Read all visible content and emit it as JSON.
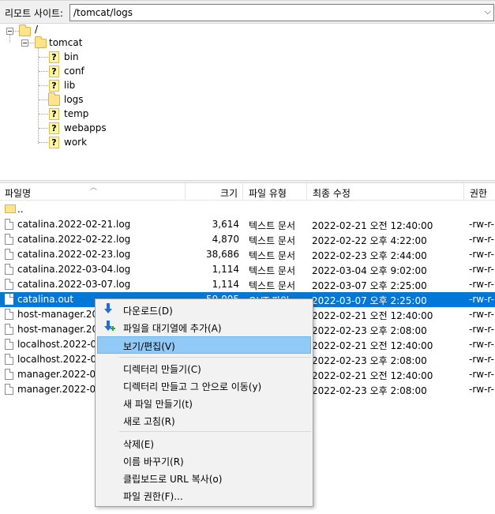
{
  "remote_site": {
    "label": "리모트 사이트:",
    "path": "/tomcat/logs"
  },
  "tree": {
    "root": "/",
    "tomcat": "tomcat",
    "children": [
      "bin",
      "conf",
      "lib",
      "logs",
      "temp",
      "webapps",
      "work"
    ]
  },
  "columns": {
    "name": "파일명",
    "size": "크기",
    "type": "파일 유형",
    "modified": "최종 수정",
    "perm": "권한"
  },
  "files": [
    {
      "name": "..",
      "size": "",
      "type": "",
      "modified": "",
      "perm": ""
    },
    {
      "name": "catalina.2022-02-21.log",
      "size": "3,614",
      "type": "텍스트 문서",
      "modified": "2022-02-21 오전 12:40:00",
      "perm": "-rw-r-"
    },
    {
      "name": "catalina.2022-02-22.log",
      "size": "4,870",
      "type": "텍스트 문서",
      "modified": "2022-02-22 오후 4:22:00",
      "perm": "-rw-r-"
    },
    {
      "name": "catalina.2022-02-23.log",
      "size": "38,686",
      "type": "텍스트 문서",
      "modified": "2022-02-23 오후 2:44:00",
      "perm": "-rw-r-"
    },
    {
      "name": "catalina.2022-03-04.log",
      "size": "1,114",
      "type": "텍스트 문서",
      "modified": "2022-03-04 오후 9:02:00",
      "perm": "-rw-r-"
    },
    {
      "name": "catalina.2022-03-07.log",
      "size": "1,114",
      "type": "텍스트 문서",
      "modified": "2022-03-07 오후 2:25:00",
      "perm": "-rw-r-"
    },
    {
      "name": "catalina.out",
      "size": "59,005",
      "type": "OUT 파일",
      "modified": "2022-03-07 오후 2:25:00",
      "perm": "-rw-r-"
    },
    {
      "name": "host-manager.202",
      "size": "",
      "type": "",
      "modified": "2022-02-21 오전 12:40:00",
      "perm": "-rw-r-"
    },
    {
      "name": "host-manager.202",
      "size": "",
      "type": "",
      "modified": "2022-02-23 오후 2:08:00",
      "perm": "-rw-r-"
    },
    {
      "name": "localhost.2022-02",
      "size": "",
      "type": "",
      "modified": "2022-02-21 오전 12:40:00",
      "perm": "-rw-r-"
    },
    {
      "name": "localhost.2022-02",
      "size": "",
      "type": "",
      "modified": "2022-02-23 오후 2:08:00",
      "perm": "-rw-r-"
    },
    {
      "name": "manager.2022-02",
      "size": "",
      "type": "",
      "modified": "2022-02-21 오전 12:40:00",
      "perm": "-rw-r-"
    },
    {
      "name": "manager.2022-02",
      "size": "",
      "type": "",
      "modified": "2022-02-23 오후 2:08:00",
      "perm": "-rw-r-"
    }
  ],
  "context_menu": {
    "download": "다운로드(D)",
    "add_queue": "파일을 대기열에 추가(A)",
    "view_edit": "보기/편집(V)",
    "mkdir": "디렉터리 만들기(C)",
    "mkdir_enter": "디렉터리 만들고 그 안으로 이동(y)",
    "new_file": "새 파일 만들기(t)",
    "refresh": "새로 고침(R)",
    "delete": "삭제(E)",
    "rename": "이름 바꾸기(R)",
    "copy_url": "클립보드로 URL 복사(o)",
    "permissions": "파일 권한(F)..."
  },
  "colors": {
    "selection": "#0078d7",
    "menu_highlight": "#91c9f7"
  }
}
